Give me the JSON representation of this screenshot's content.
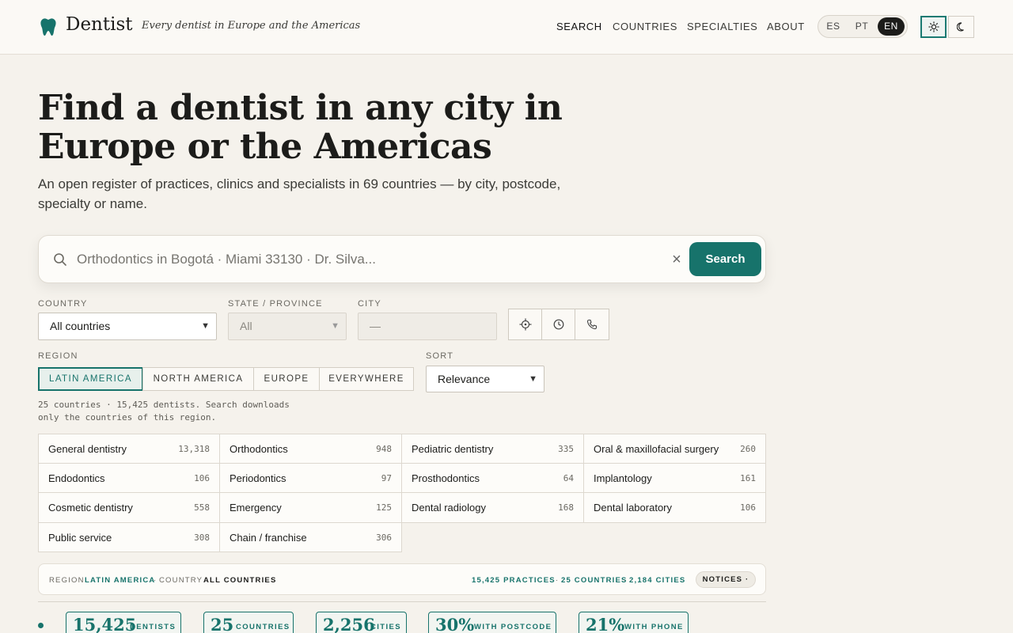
{
  "brand": {
    "name": "Dentist",
    "tagline": "Every dentist in Europe and the Americas"
  },
  "nav": {
    "search": "SEARCH",
    "countries": "COUNTRIES",
    "specialties": "SPECIALTIES",
    "about": "ABOUT"
  },
  "languages": [
    "ES",
    "PT",
    "EN"
  ],
  "active_language": "EN",
  "hero": {
    "title": "Find a dentist in any city in Europe or the Americas",
    "subtitle": "An open register of practices, clinics and specialists in 69 countries — by city, postcode, specialty or name."
  },
  "search": {
    "placeholder": "Orthodontics in Bogotá · Miami 33130 · Dr. Silva...",
    "button": "Search",
    "clear": "×"
  },
  "filters": {
    "country_label": "COUNTRY",
    "country_value": "All countries",
    "state_label": "STATE / PROVINCE",
    "state_value": "All",
    "city_label": "CITY",
    "city_value": "—",
    "region_label": "REGION",
    "regions": [
      "LATIN AMERICA",
      "NORTH AMERICA",
      "EUROPE",
      "EVERYWHERE"
    ],
    "active_region": "LATIN AMERICA",
    "sort_label": "SORT",
    "sort_value": "Relevance",
    "note": "25 countries · 15,425 dentists. Search downloads only the countries of this region."
  },
  "specialties": [
    {
      "name": "General dentistry",
      "count": "13,318"
    },
    {
      "name": "Orthodontics",
      "count": "948"
    },
    {
      "name": "Pediatric dentistry",
      "count": "335"
    },
    {
      "name": "Oral & maxillofacial surgery",
      "count": "260"
    },
    {
      "name": "Endodontics",
      "count": "106"
    },
    {
      "name": "Periodontics",
      "count": "97"
    },
    {
      "name": "Prosthodontics",
      "count": "64"
    },
    {
      "name": "Implantology",
      "count": "161"
    },
    {
      "name": "Cosmetic dentistry",
      "count": "558"
    },
    {
      "name": "Emergency",
      "count": "125"
    },
    {
      "name": "Dental radiology",
      "count": "168"
    },
    {
      "name": "Dental laboratory",
      "count": "106"
    },
    {
      "name": "Public service",
      "count": "308"
    },
    {
      "name": "Chain / franchise",
      "count": "306"
    }
  ],
  "status": {
    "region_key": "REGION",
    "region_val": "LATIN AMERICA",
    "country_key": "COUNTRY",
    "country_val": "ALL COUNTRIES",
    "practices": "15,425 PRACTICES",
    "countries": "25 COUNTRIES",
    "cities": "2,184 CITIES",
    "notices": "NOTICES ·",
    "sep": "·"
  },
  "stats": [
    {
      "num": "15,425",
      "label": "DENTISTS"
    },
    {
      "num": "25",
      "label": "COUNTRIES"
    },
    {
      "num": "2,256",
      "label": "CITIES"
    },
    {
      "num": "30%",
      "label": "WITH POSTCODE"
    },
    {
      "num": "21%",
      "label": "WITH PHONE"
    }
  ],
  "icons": [
    "tooth-icon",
    "sun-icon",
    "moon-icon",
    "search-icon",
    "close-icon",
    "locate-icon",
    "clock-icon",
    "phone-icon",
    "chevron-down-icon"
  ],
  "colors": {
    "accent": "#17736b",
    "background": "#f5f2ec",
    "ink": "#1c1c1a"
  }
}
